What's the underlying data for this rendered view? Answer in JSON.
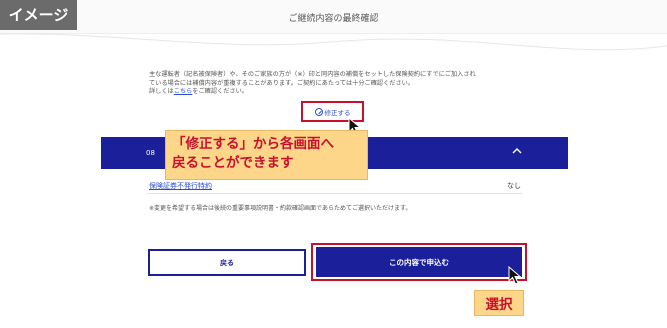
{
  "badge": "イメージ",
  "header": {
    "title": "ご継続内容の最終確認"
  },
  "notice": {
    "line1": "主な運転者（記名被保険者）や、そのご家族の方が（※）印と同内容の補償をセットした保険契約にすでにご加入され",
    "line2": "ている場合には補償内容が重複することがあります。ご契約にあたっては十分ご確認ください。",
    "line3_prefix": "詳しくは",
    "line3_link": "こちら",
    "line3_suffix": "をご確認ください。"
  },
  "edit_button": {
    "label": "修正する",
    "icon": "pencil-circle-icon"
  },
  "section": {
    "number": "08"
  },
  "callout": {
    "line1": "「修正する」から各画面へ",
    "line2": "戻ることができます"
  },
  "row": {
    "label": "保険証券不発行特約",
    "value": "なし"
  },
  "small_note": "※変更を希望する場合は後続の重要事項説明書・約款確認画面であらためてご選択いただけます。",
  "buttons": {
    "back": "戻る",
    "submit": "この内容で申込む"
  },
  "select_label": "選択",
  "colors": {
    "primary": "#1b1f9a",
    "highlight": "#c8102e",
    "callout_bg": "#fdd68a",
    "link": "#2a4bd7"
  }
}
